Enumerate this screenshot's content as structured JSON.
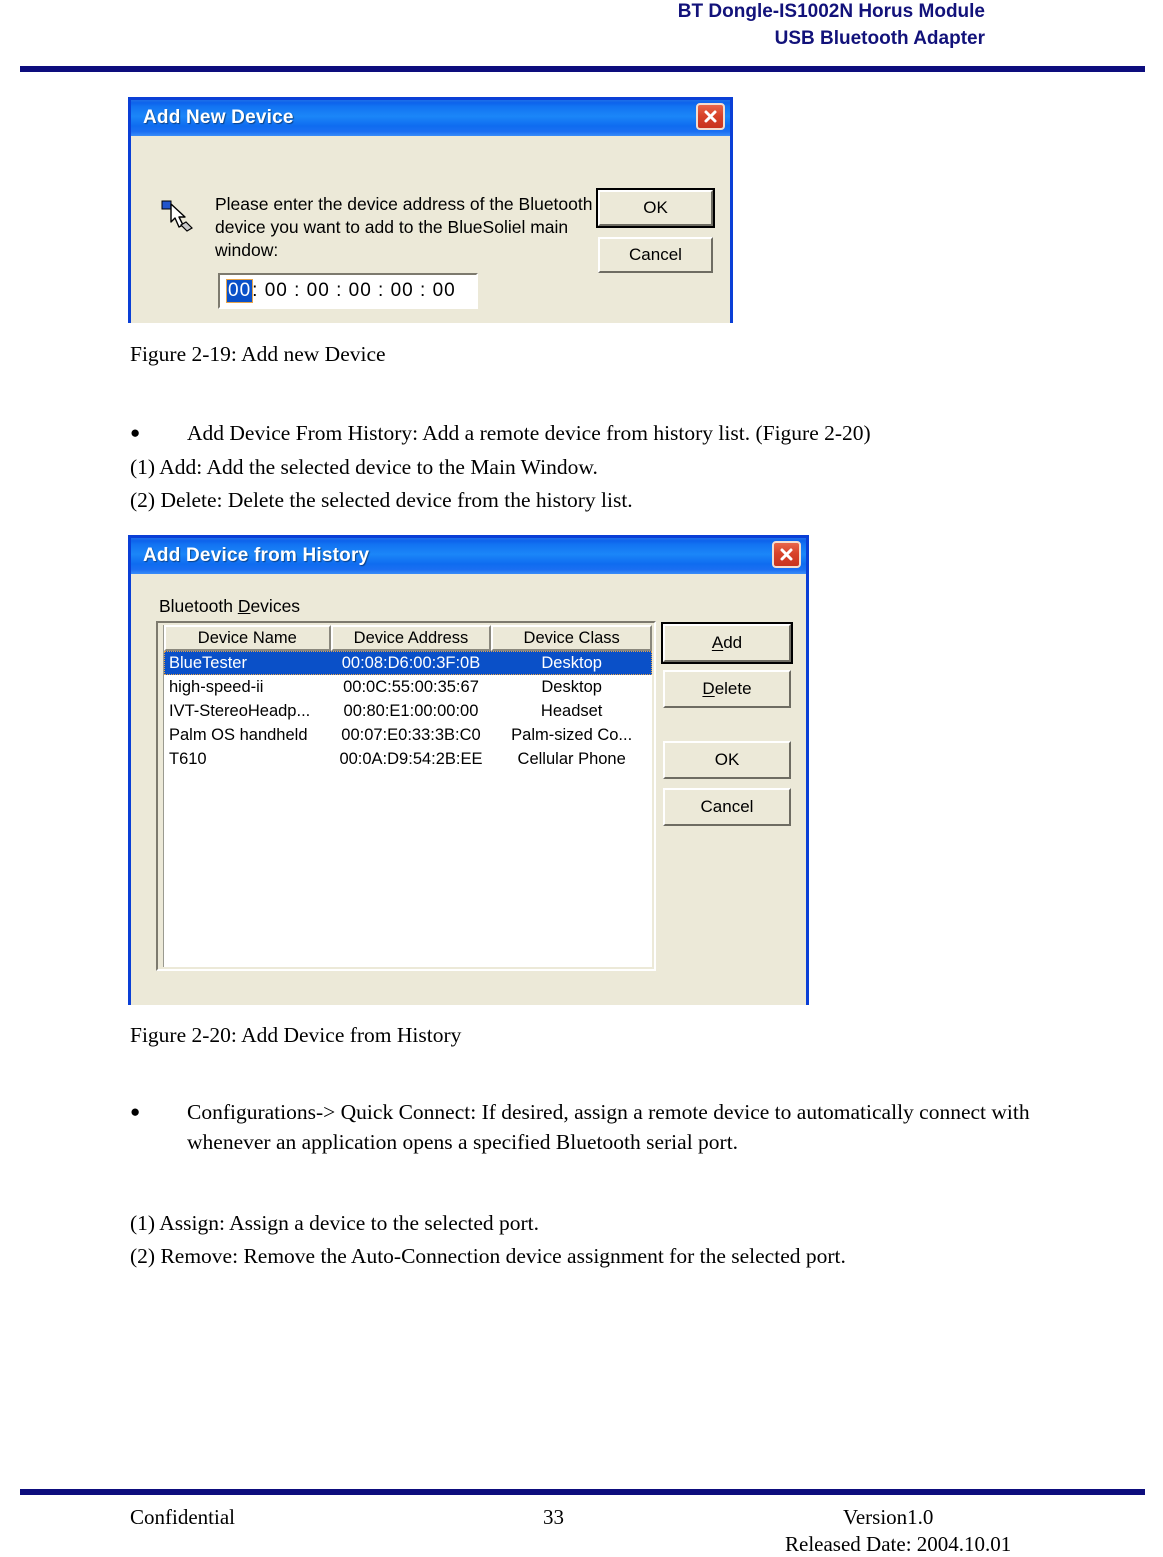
{
  "header": {
    "line1": "BT Dongle-IS1002N Horus Module",
    "line2": "USB Bluetooth Adapter"
  },
  "footer": {
    "left": "Confidential",
    "page_number": "33",
    "version": "Version1.0",
    "released": "Released Date: 2004.10.01"
  },
  "dialog_add_new_device": {
    "title": "Add New Device",
    "close_icon": "close-icon",
    "cursor_icon": "hand-pointer-icon",
    "prompt": "Please enter the device address of the Bluetooth device you want to add to the BlueSoliel main window:",
    "address_field": {
      "selected_octet": "00",
      "remaining": " : 00 : 00 : 00 : 00 : 00"
    },
    "ok_label": "OK",
    "cancel_label": "Cancel"
  },
  "caption_2_19": "Figure 2-19: Add new Device",
  "bullet_add_from_history": "Add Device From History: Add a remote device from history list. (Figure 2-20)",
  "note_1_add": "(1) Add: Add the selected device to the Main Window.",
  "note_2_delete": "(2) Delete: Delete the selected device from the history list.",
  "dialog_add_from_history": {
    "title": "Add Device from History",
    "close_icon": "close-icon",
    "group_label_pre": "Bluetooth ",
    "group_label_accel": "D",
    "group_label_post": "evices",
    "columns": [
      "Device Name",
      "Device Address",
      "Device Class"
    ],
    "rows": [
      {
        "name": "BlueTester",
        "address": "00:08:D6:00:3F:0B",
        "class": "Desktop",
        "selected": true
      },
      {
        "name": "high-speed-ii",
        "address": "00:0C:55:00:35:67",
        "class": "Desktop",
        "selected": false
      },
      {
        "name": "IVT-StereoHeadp...",
        "address": "00:80:E1:00:00:00",
        "class": "Headset",
        "selected": false
      },
      {
        "name": "Palm OS handheld",
        "address": "00:07:E0:33:3B:C0",
        "class": "Palm-sized Co...",
        "selected": false
      },
      {
        "name": "T610",
        "address": "00:0A:D9:54:2B:EE",
        "class": "Cellular Phone",
        "selected": false
      }
    ],
    "buttons": {
      "add": {
        "pre": "",
        "accel": "A",
        "post": "dd"
      },
      "delete": {
        "pre": "",
        "accel": "D",
        "post": "elete"
      },
      "ok": "OK",
      "cancel": "Cancel"
    }
  },
  "caption_2_20": "Figure 2-20: Add Device from History",
  "bullet_quick_connect": "Configurations-> Quick Connect: If desired, assign a remote device to automatically connect with whenever an application opens a specified Bluetooth serial port.",
  "note_1_assign": "(1) Assign: Assign a device to the selected port.",
  "note_2_remove": "(2) Remove: Remove the Auto-Connection device assignment for the selected port."
}
